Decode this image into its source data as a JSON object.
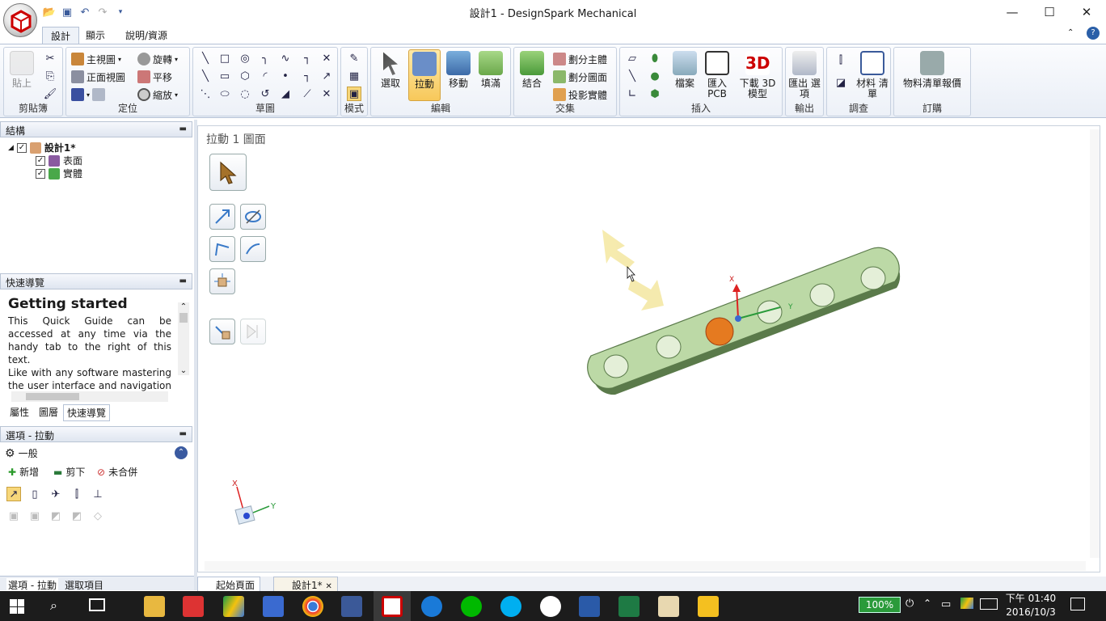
{
  "app": {
    "title": "設計1 - DesignSpark Mechanical"
  },
  "ribbon_tabs": [
    "設計",
    "顯示",
    "說明/資源"
  ],
  "ribbon": {
    "clipboard": {
      "label": "剪貼簿",
      "paste": "貼上"
    },
    "orient": {
      "label": "定位",
      "home": "主視圖",
      "front": "正面視圖",
      "rotate": "旋轉",
      "pan": "平移",
      "zoom": "縮放"
    },
    "sketch": {
      "label": "草圖"
    },
    "mode": {
      "label": "模式"
    },
    "edit": {
      "label": "編輯",
      "select": "選取",
      "pull": "拉動",
      "move": "移動",
      "fill": "填滿"
    },
    "intersect": {
      "label": "交集",
      "combine": "結合",
      "split_body": "劃分主體",
      "split_face": "劃分圖面",
      "project": "投影實體"
    },
    "insert": {
      "label": "插入",
      "file": "檔案",
      "pcb": "匯入 PCB",
      "model3d": "下載 3D 模型"
    },
    "output": {
      "label": "輸出",
      "options": "匯出 選項"
    },
    "investigate": {
      "label": "調查",
      "bom": "材料 清單"
    },
    "order": {
      "label": "訂購",
      "quote": "物料清單報價"
    }
  },
  "structure": {
    "title": "結構",
    "root": "設計1*",
    "items": [
      "表面",
      "實體"
    ]
  },
  "quickguide": {
    "title": "快速導覽",
    "heading": "Getting started",
    "p1": "This Quick Guide can be accessed at any time via the handy tab to the right of this text.",
    "p2": "Like with any software mastering the user interface and navigation takes a bit of practice. Please select a topic of"
  },
  "panel_tabs": [
    "屬性",
    "圖層",
    "快速導覽"
  ],
  "options": {
    "title": "選項 - 拉動",
    "section": "一般",
    "add": "新增",
    "cut": "剪下",
    "nomerge": "未合併"
  },
  "bottom_tabs": [
    "選項 - 拉動",
    "選取項目"
  ],
  "canvas": {
    "title": "拉動 1 圖面",
    "axis_x": "X",
    "axis_y": "Y"
  },
  "doc_tabs": [
    "起始頁面",
    "設計1*"
  ],
  "taskbar": {
    "zoom": "100%",
    "time": "下午 01:40",
    "date": "2016/10/3"
  },
  "colors": {
    "part": "#bcd9a6",
    "part_edge": "#5a7a4a",
    "accent": "#f5d38a",
    "taskbar": "#1c1c1c"
  }
}
